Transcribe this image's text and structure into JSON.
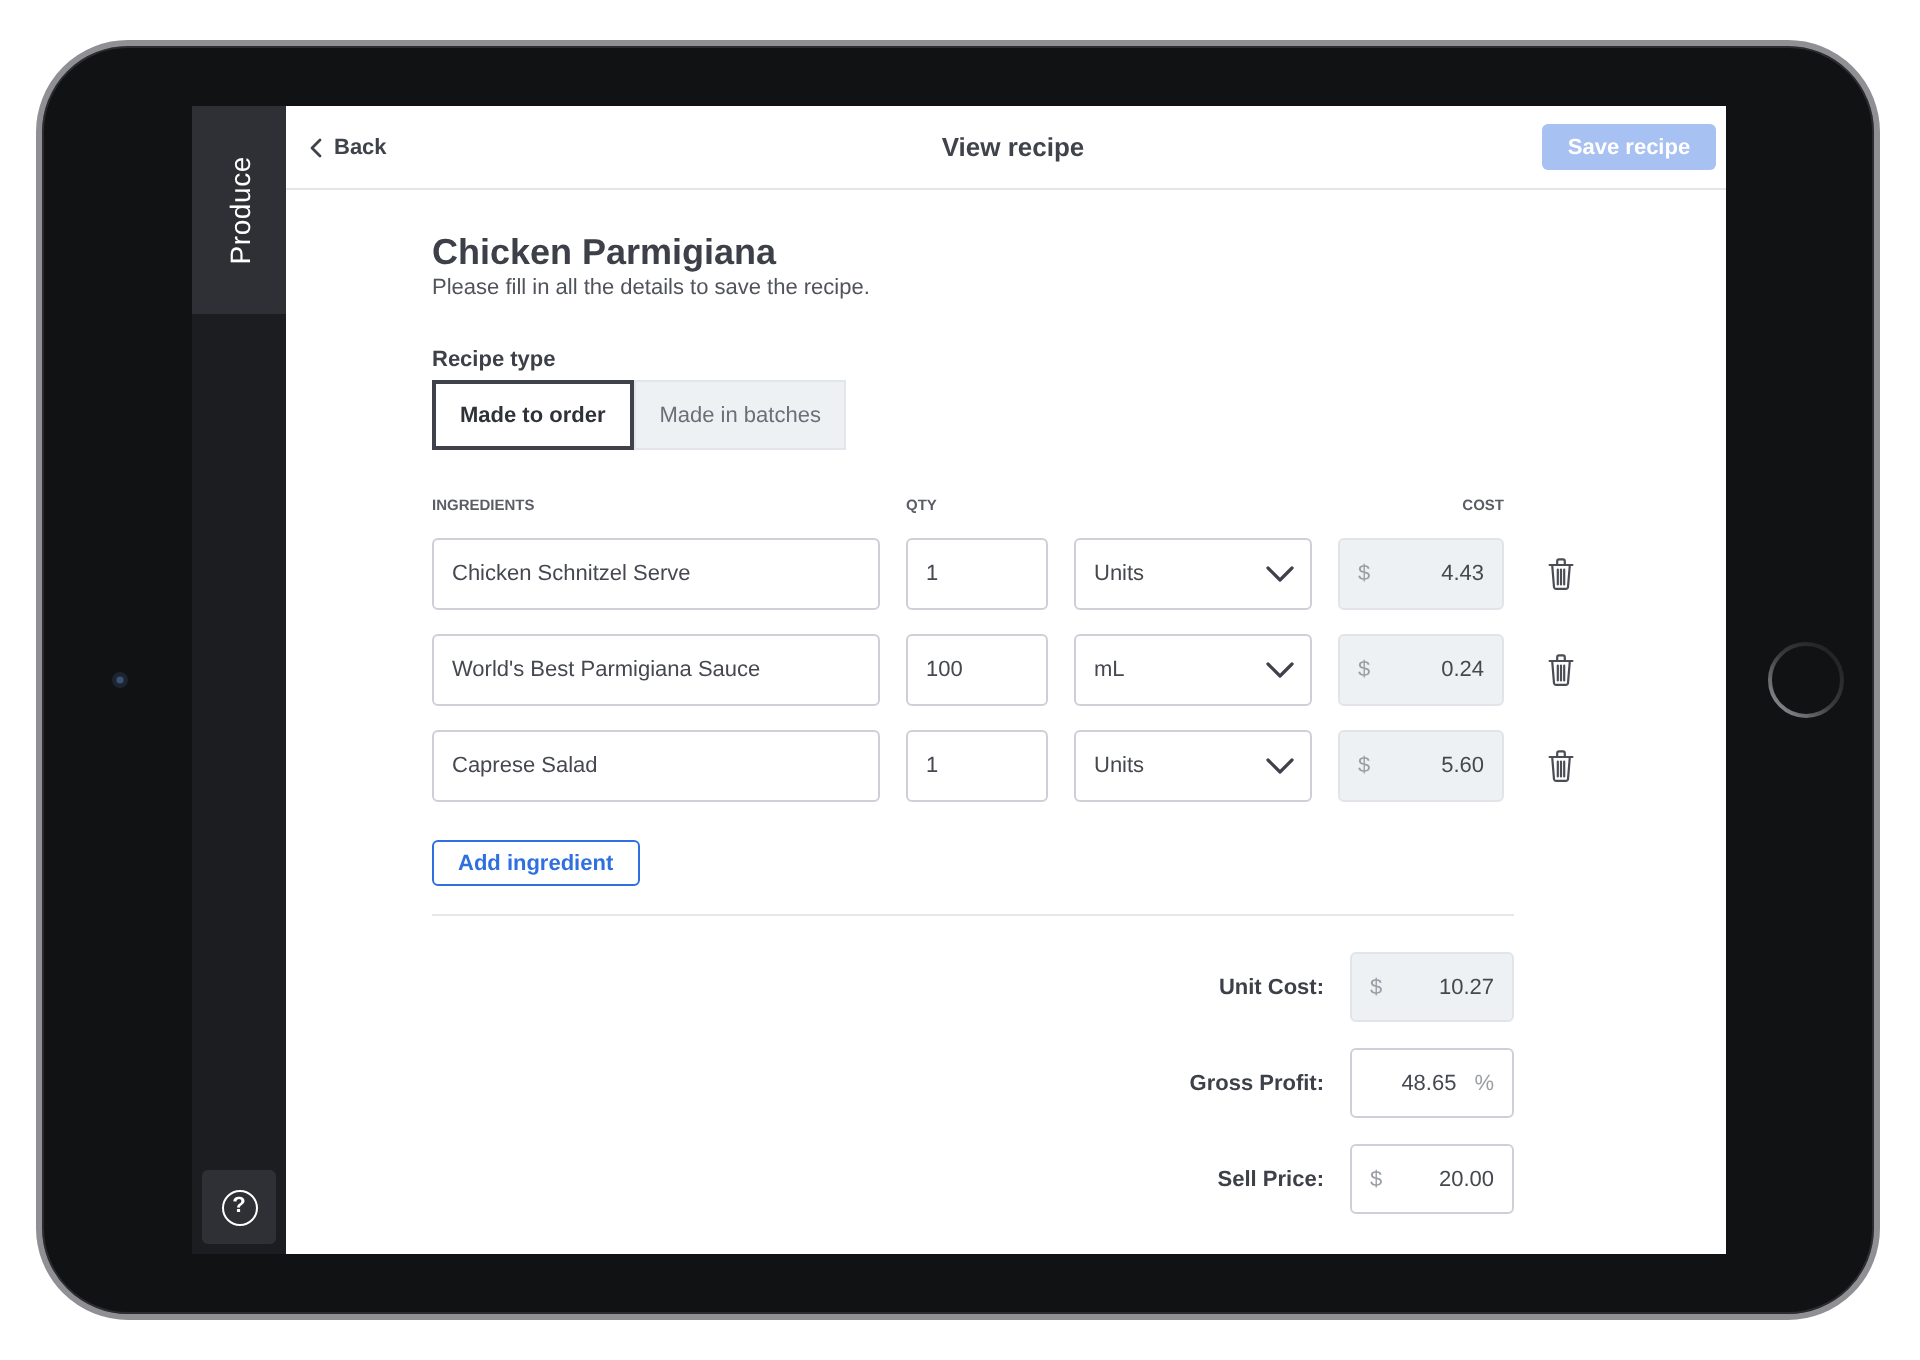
{
  "sidebar": {
    "tabs": [
      {
        "label": "Produce",
        "selected": true
      }
    ],
    "help_button": {
      "label": "?"
    }
  },
  "top_bar": {
    "back_label": "Back",
    "title": "View recipe",
    "save_button": {
      "label": "Save recipe",
      "disabled": true
    }
  },
  "recipe": {
    "title": "Chicken Parmigiana",
    "subtitle": "Please fill in all the details to save the recipe."
  },
  "recipe_type": {
    "label": "Recipe type",
    "options": [
      {
        "label": "Made to order",
        "selected": true
      },
      {
        "label": "Made in batches",
        "selected": false
      }
    ]
  },
  "ingredients": {
    "columns": [
      {
        "kind": "name",
        "label": "INGREDIENTS"
      },
      {
        "kind": "qty",
        "label": "QTY"
      },
      {
        "kind": "cost",
        "label": "COST"
      }
    ],
    "rows": [
      {
        "name": "Chicken Schnitzel Serve",
        "qty": "1",
        "unit": "Units",
        "cost": {
          "currency": "$",
          "value": "4.43",
          "readonly": true
        }
      },
      {
        "name": "World's Best Parmigiana Sauce",
        "qty": "100",
        "unit": "mL",
        "cost": {
          "currency": "$",
          "value": "0.24",
          "readonly": true
        }
      },
      {
        "name": "Caprese Salad",
        "qty": "1",
        "unit": "Units",
        "cost": {
          "currency": "$",
          "value": "5.60",
          "readonly": true
        }
      }
    ],
    "add_button": "Add ingredient"
  },
  "totals": [
    {
      "label": "Unit Cost:",
      "prefix": "$",
      "value": "10.27",
      "readonly": true
    },
    {
      "label": "Gross Profit:",
      "value": "48.65",
      "suffix": "%",
      "readonly": false
    },
    {
      "label": "Sell Price:",
      "prefix": "$",
      "value": "20.00",
      "readonly": false
    }
  ]
}
